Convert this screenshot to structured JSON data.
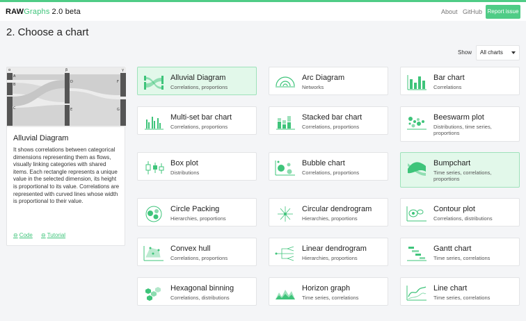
{
  "navbar": {
    "brand_bold": "RAW",
    "brand_light": "Graphs",
    "version": "2.0 beta",
    "links": [
      "About",
      "GitHub"
    ],
    "report_label": "Report issue",
    "accent": "#4fcc86"
  },
  "page": {
    "title": "2. Choose a chart"
  },
  "filter": {
    "label": "Show",
    "selected": "All charts"
  },
  "preview": {
    "title": "Alluvial Diagram",
    "description": "It shows correlations between categorical dimensions representing them as flows, visually linking categories with shared items. Each rectangle represents a unique value in the selected dimension, its height is proportional to its value. Correlations are represented with curved lines whose width is proportional to their value.",
    "code_label": "Code",
    "tutorial_label": "Tutorial",
    "diagram_labels": {
      "col1": "α",
      "col2": "β",
      "col3": "γ",
      "left": [
        "A",
        "B",
        "C"
      ],
      "mid": [
        "D",
        "E"
      ],
      "right": [
        "F",
        "G"
      ]
    }
  },
  "charts": [
    {
      "name": "Alluvial Diagram",
      "category": "Correlations, proportions",
      "icon": "alluvial-icon",
      "selected": true
    },
    {
      "name": "Arc Diagram",
      "category": "Networks",
      "icon": "arc-icon"
    },
    {
      "name": "Bar chart",
      "category": "Correlations",
      "icon": "bar-icon"
    },
    {
      "name": "Multi-set bar chart",
      "category": "Correlations, proportions",
      "icon": "multiset-bar-icon"
    },
    {
      "name": "Stacked bar chart",
      "category": "Correlations, proportions",
      "icon": "stacked-bar-icon"
    },
    {
      "name": "Beeswarm plot",
      "category": "Distributions, time series, proportions",
      "icon": "beeswarm-icon"
    },
    {
      "name": "Box plot",
      "category": "Distributions",
      "icon": "boxplot-icon"
    },
    {
      "name": "Bubble chart",
      "category": "Correlations, proportions",
      "icon": "bubble-icon"
    },
    {
      "name": "Bumpchart",
      "category": "Time series, correlations, proportions",
      "icon": "bump-icon",
      "highlight": true
    },
    {
      "name": "Circle Packing",
      "category": "Hierarchies, proportions",
      "icon": "circle-packing-icon"
    },
    {
      "name": "Circular dendrogram",
      "category": "Hierarchies, proportions",
      "icon": "circular-dendrogram-icon"
    },
    {
      "name": "Contour plot",
      "category": "Correlations, distributions",
      "icon": "contour-icon"
    },
    {
      "name": "Convex hull",
      "category": "Correlations, proportions",
      "icon": "convex-hull-icon"
    },
    {
      "name": "Linear dendrogram",
      "category": "Hierarchies, proportions",
      "icon": "linear-dendrogram-icon"
    },
    {
      "name": "Gantt chart",
      "category": "Time series, correlations",
      "icon": "gantt-icon"
    },
    {
      "name": "Hexagonal binning",
      "category": "Correlations, distributions",
      "icon": "hexbin-icon"
    },
    {
      "name": "Horizon graph",
      "category": "Time series, correlations",
      "icon": "horizon-icon"
    },
    {
      "name": "Line chart",
      "category": "Time series, correlations",
      "icon": "line-icon"
    }
  ]
}
